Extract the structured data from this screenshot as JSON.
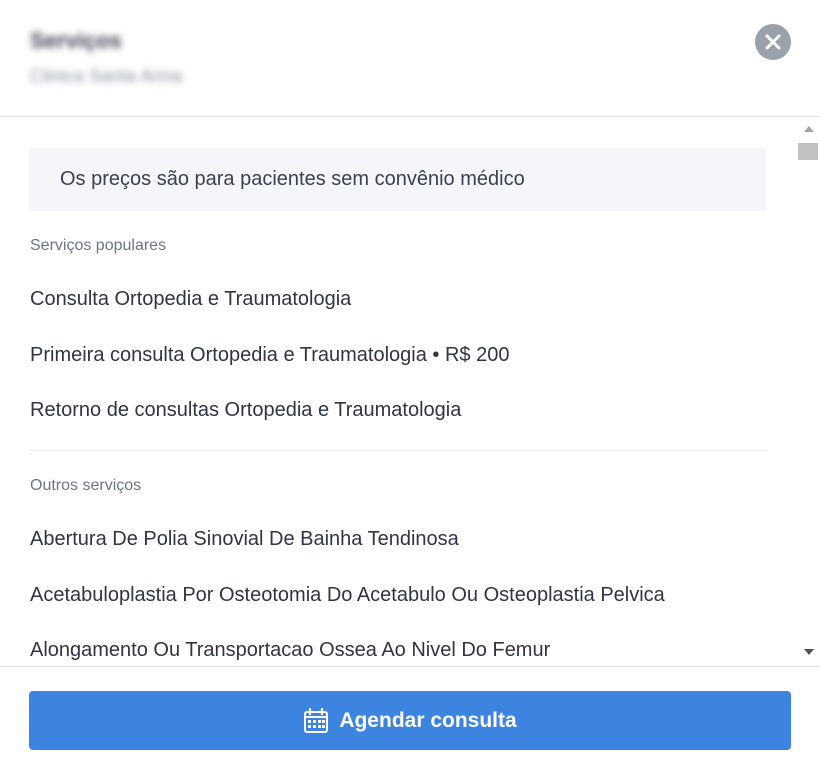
{
  "header": {
    "title": "Serviços",
    "subtitle": "Clinica Santa Anna",
    "close_icon": "close-icon"
  },
  "notice": {
    "text": "Os preços são para pacientes sem convênio médico"
  },
  "popular": {
    "label": "Serviços populares",
    "items": [
      "Consulta Ortopedia e Traumatologia",
      "Primeira consulta Ortopedia e Traumatologia • R$ 200",
      "Retorno de consultas Ortopedia e Traumatologia"
    ]
  },
  "other": {
    "label": "Outros serviços",
    "items": [
      "Abertura De Polia Sinovial De Bainha Tendinosa",
      "Acetabuloplastia Por Osteotomia Do Acetabulo Ou Osteoplastia Pelvica",
      "Alongamento Ou Transportacao Ossea Ao Nivel Do Femur"
    ]
  },
  "footer": {
    "button_label": "Agendar consulta",
    "button_icon": "calendar-icon"
  },
  "colors": {
    "primary": "#3d84e0",
    "close_bg": "#9aa1ac",
    "notice_bg": "#f4f6f9"
  }
}
